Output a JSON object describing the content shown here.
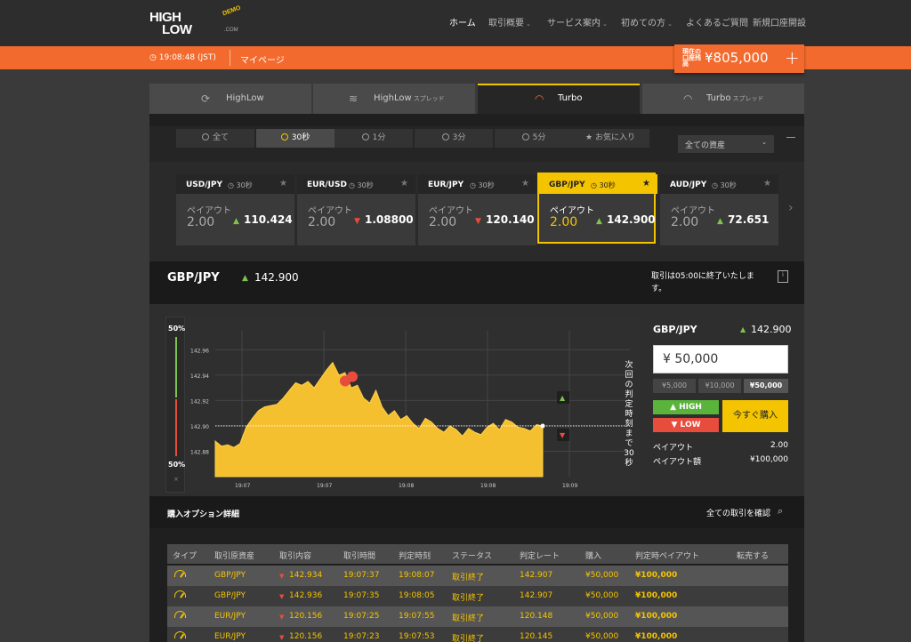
{
  "nav": {
    "logo_high": "HIGH",
    "logo_low": "LOW",
    "logo_demo": "DEMO",
    "logo_com": ".COM",
    "items": [
      {
        "label": "ホーム",
        "chevron": false,
        "active": true
      },
      {
        "label": "取引概要",
        "chevron": true
      },
      {
        "label": "サービス案内",
        "chevron": true
      },
      {
        "label": "初めての方",
        "chevron": true
      },
      {
        "label": "よくあるご質問",
        "chevron": false
      },
      {
        "label": "新規口座開設",
        "chevron": false
      }
    ]
  },
  "topbar": {
    "time": "19:08:48 (JST)",
    "mypage": "マイページ",
    "balance_label": "現在の口座残高",
    "balance": "¥805,000",
    "plus": "+"
  },
  "modes": [
    {
      "label": "HighLow",
      "sub": "",
      "active": false
    },
    {
      "label": "HighLow",
      "sub": "スプレッド",
      "active": false
    },
    {
      "label": "Turbo",
      "sub": "",
      "active": true
    },
    {
      "label": "Turbo",
      "sub": "スプレッド",
      "active": false
    }
  ],
  "durations": [
    {
      "label": "全て",
      "active": false
    },
    {
      "label": "30秒",
      "active": true
    },
    {
      "label": "1分",
      "active": false
    },
    {
      "label": "3分",
      "active": false
    },
    {
      "label": "5分",
      "active": false
    },
    {
      "label": "お気に入り",
      "active": false
    }
  ],
  "asset_select": "全ての資産",
  "cards": [
    {
      "pair": "USD/JPY",
      "time": "30秒",
      "payout_label": "ペイアウト",
      "payout": "2.00",
      "dir": "up",
      "price": "110.424",
      "selected": false
    },
    {
      "pair": "EUR/USD",
      "time": "30秒",
      "payout_label": "ペイアウト",
      "payout": "2.00",
      "dir": "down",
      "price": "1.08800",
      "selected": false
    },
    {
      "pair": "EUR/JPY",
      "time": "30秒",
      "payout_label": "ペイアウト",
      "payout": "2.00",
      "dir": "down",
      "price": "120.140",
      "selected": false
    },
    {
      "pair": "GBP/JPY",
      "time": "30秒",
      "payout_label": "ペイアウト",
      "payout": "2.00",
      "dir": "up",
      "price": "142.900",
      "selected": true
    },
    {
      "pair": "AUD/JPY",
      "time": "30秒",
      "payout_label": "ペイアウト",
      "payout": "2.00",
      "dir": "up",
      "price": "72.651",
      "selected": false
    }
  ],
  "selected": {
    "pair": "GBP/JPY",
    "price": "142.900",
    "end_notice": "取引は05:00に終了いたします。"
  },
  "meter": {
    "top": "50%",
    "bottom": "50%"
  },
  "chart_data": {
    "type": "area",
    "ylim": [
      142.86,
      142.975
    ],
    "yticks": [
      "142.96",
      "142.94",
      "142.92",
      "142.90",
      "142.88"
    ],
    "xticks": [
      "19:07",
      "19:07",
      "19:08",
      "19:08",
      "19:09"
    ],
    "strike": 142.9,
    "values": [
      142.888,
      142.884,
      142.885,
      142.883,
      142.886,
      142.899,
      142.906,
      142.912,
      142.915,
      142.916,
      142.917,
      142.922,
      142.928,
      142.934,
      142.932,
      142.935,
      142.93,
      142.937,
      142.944,
      142.95,
      142.94,
      142.942,
      142.93,
      142.932,
      142.922,
      142.918,
      142.928,
      142.915,
      142.908,
      142.912,
      142.905,
      142.908,
      142.902,
      142.898,
      142.906,
      142.903,
      142.898,
      142.895,
      142.9,
      142.897,
      142.892,
      142.898,
      142.895,
      142.893,
      142.899,
      142.902,
      142.897,
      142.905,
      142.903,
      142.899,
      142.898,
      142.896,
      142.901,
      142.9
    ],
    "vertical_label": "次回の判定時刻まで30秒"
  },
  "order": {
    "pair": "GBP/JPY",
    "price": "142.900",
    "amount": "¥ 50,000",
    "quick": [
      "¥5,000",
      "¥10,000",
      "¥50,000"
    ],
    "high": "HIGH",
    "low": "LOW",
    "buy": "今すぐ購入",
    "payout_label": "ペイアウト",
    "payout": "2.00",
    "payout_amount_label": "ペイアウト額",
    "payout_amount": "¥100,000"
  },
  "details": {
    "title": "購入オプション詳細",
    "all_link": "全ての取引を確認",
    "headers": [
      "タイプ",
      "取引原資産",
      "取引内容",
      "取引時間",
      "判定時刻",
      "ステータス",
      "判定レート",
      "購入",
      "判定時ペイアウト",
      "転売する"
    ],
    "rows": [
      {
        "asset": "GBP/JPY",
        "content": "142.934",
        "time": "19:07:37",
        "judge": "19:08:07",
        "status": "取引終了",
        "rate": "142.907",
        "buy": "¥50,000",
        "payout": "¥100,000"
      },
      {
        "asset": "GBP/JPY",
        "content": "142.936",
        "time": "19:07:35",
        "judge": "19:08:05",
        "status": "取引終了",
        "rate": "142.907",
        "buy": "¥50,000",
        "payout": "¥100,000"
      },
      {
        "asset": "EUR/JPY",
        "content": "120.156",
        "time": "19:07:25",
        "judge": "19:07:55",
        "status": "取引終了",
        "rate": "120.148",
        "buy": "¥50,000",
        "payout": "¥100,000"
      },
      {
        "asset": "EUR/JPY",
        "content": "120.156",
        "time": "19:07:23",
        "judge": "19:07:53",
        "status": "取引終了",
        "rate": "120.145",
        "buy": "¥50,000",
        "payout": "¥100,000"
      }
    ]
  }
}
